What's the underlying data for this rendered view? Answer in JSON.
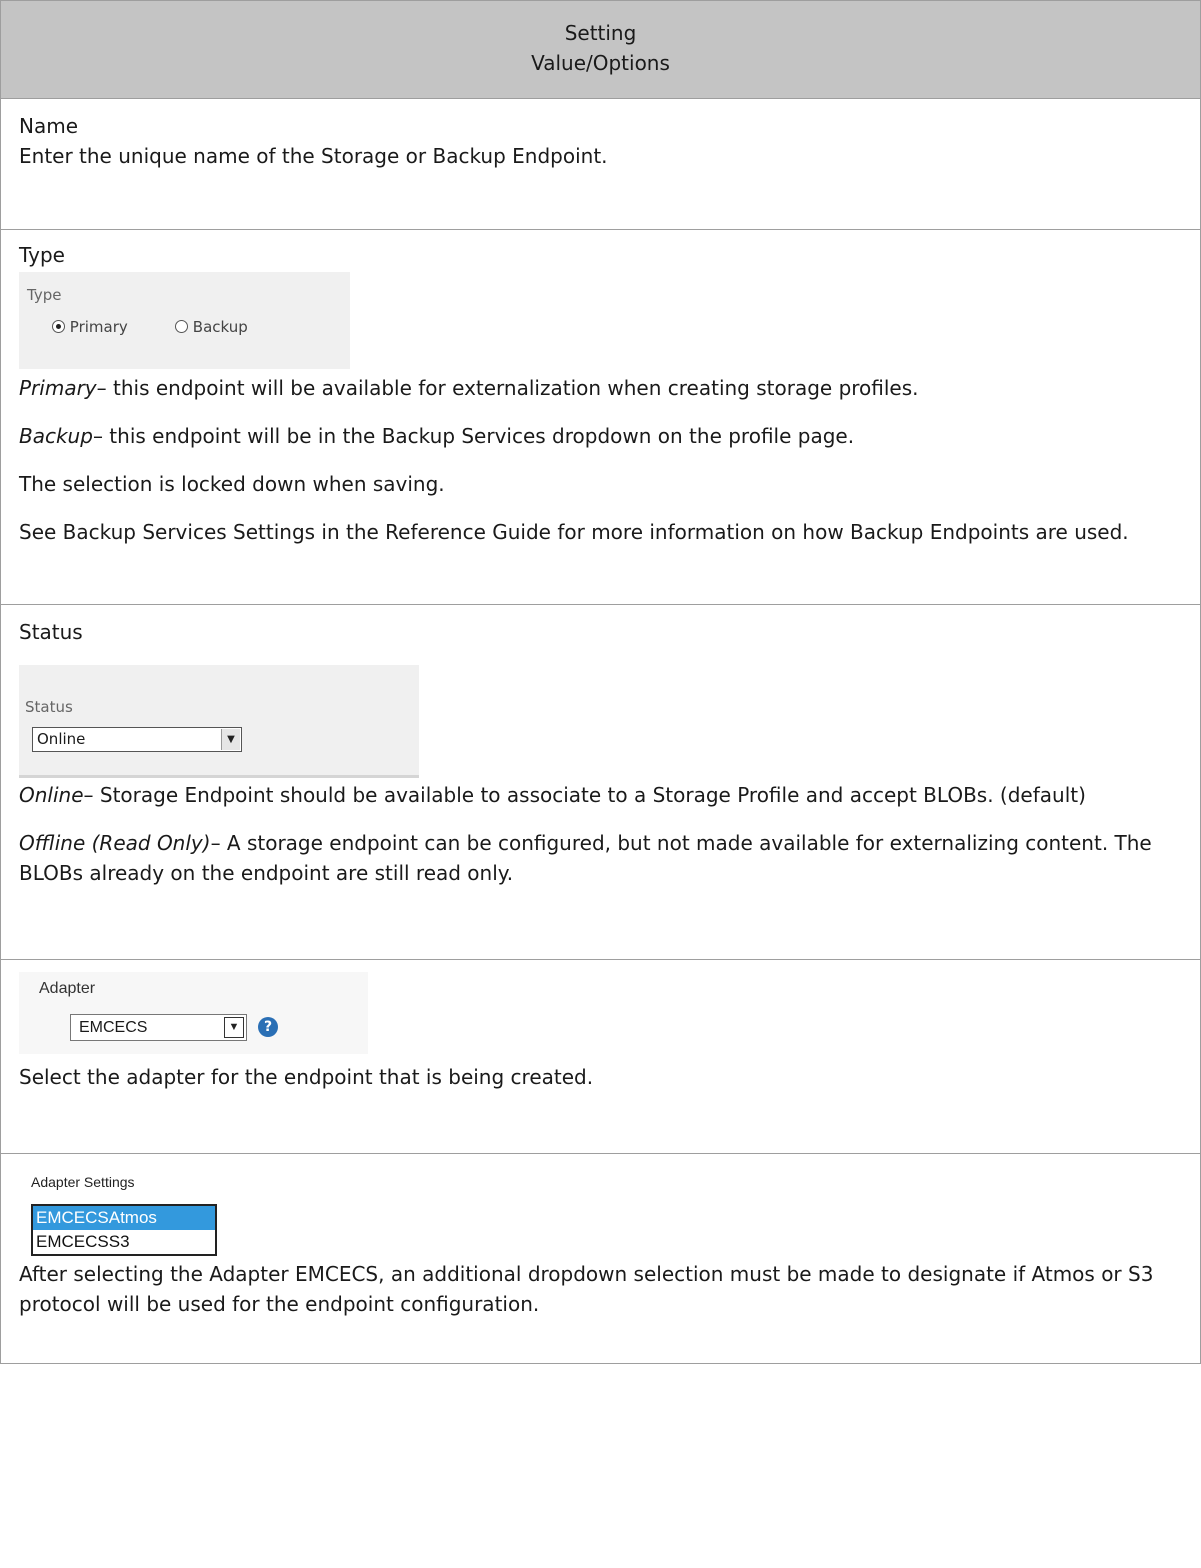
{
  "header": {
    "col1": "Setting",
    "col2": "Value/Options"
  },
  "rows": {
    "name": {
      "title": "Name",
      "desc": "Enter the unique name of the Storage or Backup Endpoint."
    },
    "type": {
      "title": "Type",
      "widget_label": "Type",
      "option_primary": "Primary",
      "option_backup": "Backup",
      "selected": "Primary",
      "primary_term": "Primary",
      "primary_desc": "– this endpoint will be available for externalization when creating storage profiles.",
      "backup_term": "Backup",
      "backup_desc": "– this endpoint will be in the Backup Services dropdown on the profile page.",
      "locked_note": "The selection is locked down when saving.",
      "see_note": "See Backup Services Settings in the Reference Guide for more information on how Backup Endpoints are used."
    },
    "status": {
      "title": "Status",
      "widget_label": "Status",
      "selected_value": "Online",
      "online_term": "Online",
      "online_desc": "– Storage Endpoint should be available to associate to a Storage Profile and accept BLOBs. (default)",
      "offline_term": "Offline (Read Only)",
      "offline_desc": "– A storage endpoint can be configured, but not made available for externalizing content. The BLOBs already on the endpoint are still read only."
    },
    "adapter": {
      "widget_label": "Adapter",
      "selected_value": "EMCECS",
      "help_glyph": "?",
      "desc": "Select the adapter for the endpoint that is being created."
    },
    "adapter_settings": {
      "widget_label": "Adapter Settings",
      "options": [
        "EMCECSAtmos",
        "EMCECSS3"
      ],
      "highlighted": "EMCECSAtmos",
      "desc": "After selecting the Adapter EMCECS, an additional dropdown selection must be made to designate if Atmos or S3 protocol will be used for the endpoint configuration."
    }
  },
  "icons": {
    "dropdown": "chevron-down-icon",
    "help": "help-circle-icon"
  },
  "colors": {
    "header_bg": "#c4c4c4",
    "widget_bg": "#f0f0f0",
    "highlight": "#3399dd",
    "help": "#2a6fb5"
  }
}
